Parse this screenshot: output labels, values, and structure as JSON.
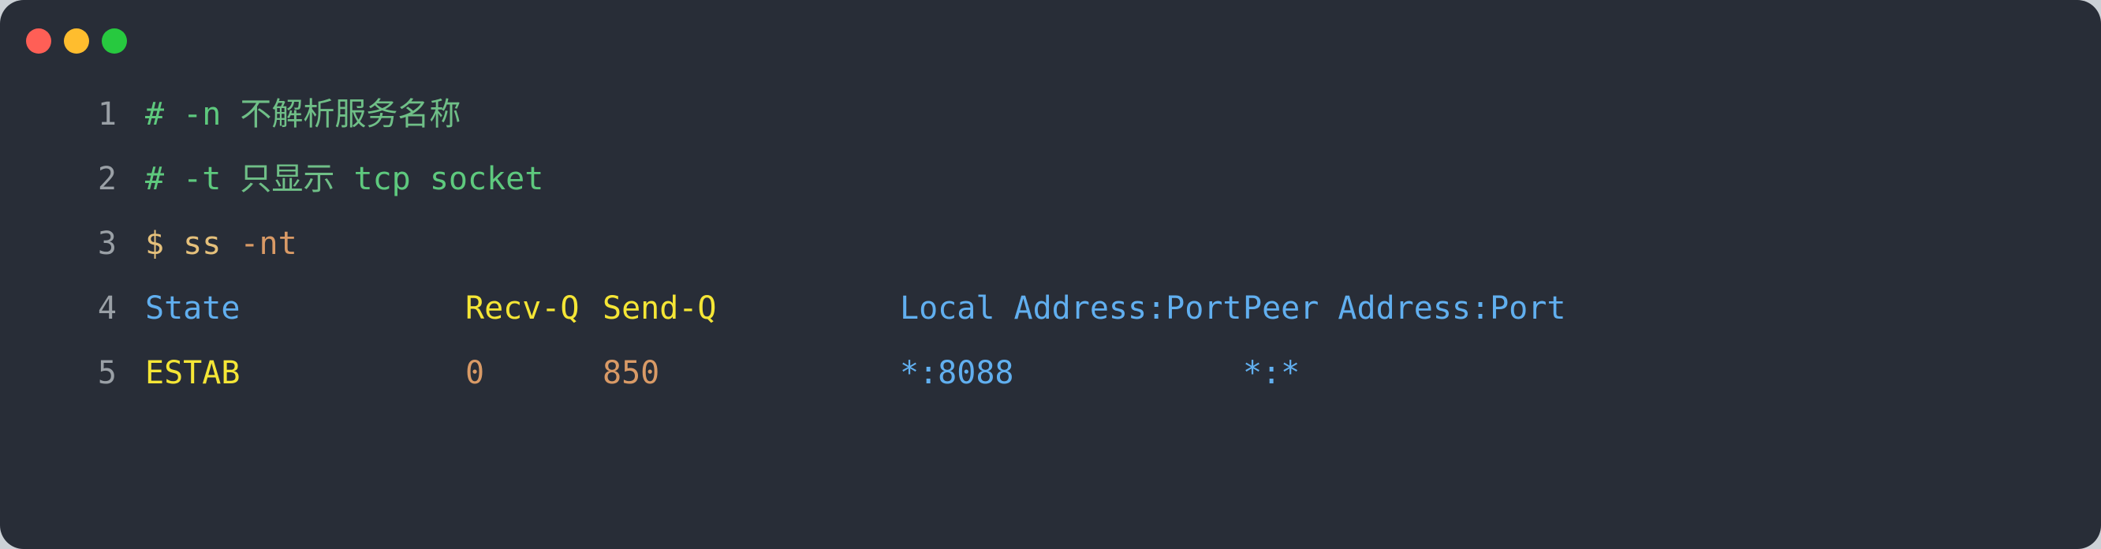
{
  "window": {
    "background_color": "#282d37",
    "page_background_color": "#ccd1d6",
    "controls": {
      "close_label": "",
      "minimize_label": "",
      "maximize_label": "",
      "close_color": "#ff5f56",
      "minimize_color": "#ffbd2e",
      "maximize_color": "#27c93f"
    }
  },
  "colors": {
    "line_number": "#9aa0a6",
    "comment_green": "#5ec97e",
    "comment_cjk_green": "#6fbf87",
    "prompt_gold": "#e5c07b",
    "flag_orange": "#d99a66",
    "number_orange": "#d99a66",
    "address_blue": "#61afef",
    "header_yellow": "#f5e636",
    "state_yellow": "#f5e636"
  },
  "code": {
    "line_numbers": [
      "1",
      "2",
      "3",
      "4",
      "5"
    ],
    "lines": [
      {
        "number": "1",
        "hash": "#",
        "flag": " -n ",
        "cjk": "不解析服务名称"
      },
      {
        "number": "2",
        "hash": "#",
        "flag": " -t ",
        "cjk": "只显示",
        "tail": " tcp socket"
      },
      {
        "number": "3",
        "prompt": "$",
        "command": " ss",
        "flags": " -nt"
      },
      {
        "number": "4",
        "col_state": "State",
        "col_recvq": "Recv-Q",
        "col_sendq": "Send-Q",
        "col_local": "Local Address:Port",
        "col_peer": "Peer Address:Port"
      },
      {
        "number": "5",
        "val_state": "ESTAB",
        "val_recvq": "0",
        "val_sendq": "850",
        "val_local": "*:8088",
        "val_peer": "*:*"
      }
    ]
  }
}
